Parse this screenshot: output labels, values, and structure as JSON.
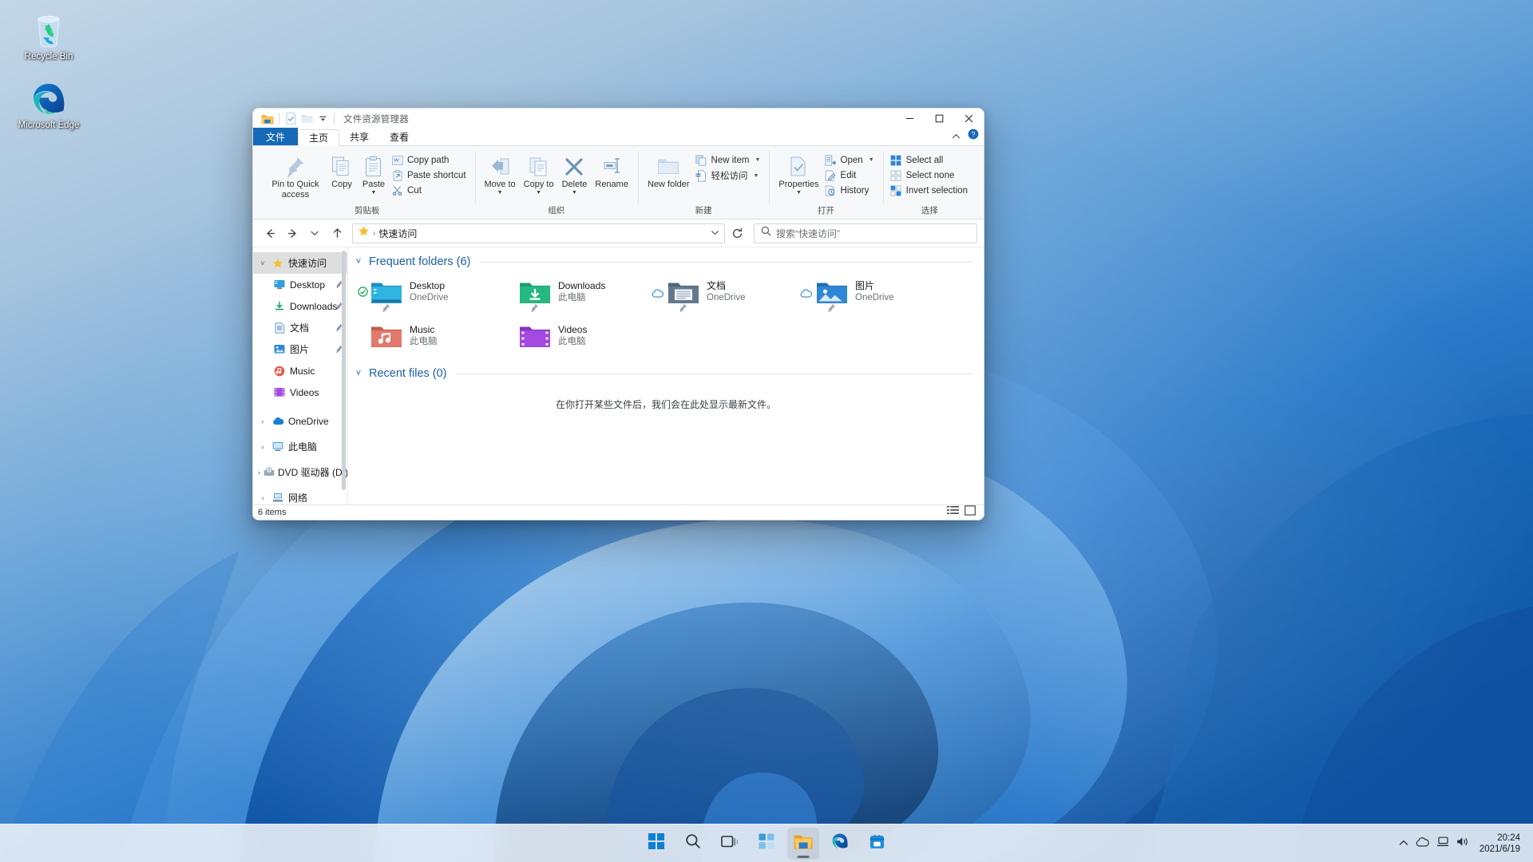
{
  "desktop": {
    "icons": [
      {
        "name": "recycle-bin",
        "label": "Recycle Bin"
      },
      {
        "name": "microsoft-edge",
        "label": "Microsoft Edge"
      }
    ]
  },
  "window": {
    "title": "文件资源管理器",
    "quick_access_toolbar": [
      {
        "name": "explorer-icon",
        "label": ""
      },
      {
        "name": "properties-icon",
        "label": ""
      },
      {
        "name": "new-folder-icon",
        "label": ""
      },
      {
        "name": "customize-dropdown",
        "label": ""
      }
    ],
    "controls": {
      "minimize": "─",
      "maximize": "□",
      "close": "✕"
    }
  },
  "tabs": [
    {
      "name": "tab-file",
      "label": "文件",
      "state": "file-menu"
    },
    {
      "name": "tab-home",
      "label": "主页",
      "state": "active"
    },
    {
      "name": "tab-share",
      "label": "共享",
      "state": "normal"
    },
    {
      "name": "tab-view",
      "label": "查看",
      "state": "normal"
    }
  ],
  "ribbon": {
    "collapse_label": "⌃",
    "help_label": "?",
    "groups": [
      {
        "name": "clipboard",
        "label": "剪贴板",
        "big_buttons": [
          {
            "name": "pin-to-quick-access",
            "label": "Pin to Quick access",
            "icon": "pin-icon"
          },
          {
            "name": "copy-button",
            "label": "Copy",
            "icon": "copy-icon"
          },
          {
            "name": "paste-button",
            "label": "Paste",
            "icon": "paste-icon"
          }
        ],
        "small_buttons": [
          {
            "name": "copy-path-button",
            "label": "Copy path",
            "icon": "copy-path-icon"
          },
          {
            "name": "paste-shortcut-button",
            "label": "Paste shortcut",
            "icon": "paste-shortcut-icon"
          },
          {
            "name": "cut-button",
            "label": "Cut",
            "icon": "scissors-icon"
          }
        ]
      },
      {
        "name": "organize",
        "label": "组织",
        "big_buttons": [
          {
            "name": "move-to-button",
            "label": "Move to",
            "icon": "move-to-icon",
            "dropdown": true
          },
          {
            "name": "copy-to-button",
            "label": "Copy to",
            "icon": "copy-to-icon",
            "dropdown": true
          },
          {
            "name": "delete-button",
            "label": "Delete",
            "icon": "delete-x-icon",
            "dropdown": true
          },
          {
            "name": "rename-button",
            "label": "Rename",
            "icon": "rename-icon"
          }
        ],
        "small_buttons": []
      },
      {
        "name": "new",
        "label": "新建",
        "big_buttons": [
          {
            "name": "new-folder-button",
            "label": "New folder",
            "icon": "new-folder-icon"
          }
        ],
        "small_buttons": [
          {
            "name": "new-item-button",
            "label": "New item",
            "icon": "new-item-icon",
            "dropdown": true
          },
          {
            "name": "easy-access-button",
            "label": "轻松访问",
            "icon": "easy-access-icon",
            "dropdown": true
          }
        ]
      },
      {
        "name": "open",
        "label": "打开",
        "big_buttons": [
          {
            "name": "properties-button",
            "label": "Properties",
            "icon": "properties-icon",
            "dropdown": true
          }
        ],
        "small_buttons": [
          {
            "name": "open-button",
            "label": "Open",
            "icon": "open-icon",
            "dropdown": true
          },
          {
            "name": "edit-button",
            "label": "Edit",
            "icon": "edit-icon"
          },
          {
            "name": "history-button",
            "label": "History",
            "icon": "history-icon"
          }
        ]
      },
      {
        "name": "select",
        "label": "选择",
        "big_buttons": [],
        "small_buttons": [
          {
            "name": "select-all-button",
            "label": "Select all",
            "icon": "select-all-icon"
          },
          {
            "name": "select-none-button",
            "label": "Select none",
            "icon": "select-none-icon"
          },
          {
            "name": "invert-selection-button",
            "label": "Invert selection",
            "icon": "invert-selection-icon"
          }
        ]
      }
    ]
  },
  "navigation": {
    "back": "←",
    "forward": "→",
    "recent": "˅",
    "up": "↑",
    "breadcrumb": {
      "icon": "star-icon",
      "separator": "›",
      "label": "快速访问"
    },
    "refresh_title": "refresh",
    "search": {
      "placeholder": "搜索“快速访问”",
      "icon": "search-icon"
    }
  },
  "sidebar": {
    "items": [
      {
        "name": "sidebar-item-quick-access",
        "label": "快速访问",
        "icon": "star-icon",
        "chevron": "˅",
        "indent": false,
        "selected": true,
        "pinned": false
      },
      {
        "name": "sidebar-item-desktop",
        "label": "Desktop",
        "icon": "desktop-icon",
        "chevron": "",
        "indent": true,
        "selected": false,
        "pinned": true
      },
      {
        "name": "sidebar-item-downloads",
        "label": "Downloads",
        "icon": "downloads-icon",
        "chevron": "",
        "indent": true,
        "selected": false,
        "pinned": true
      },
      {
        "name": "sidebar-item-documents",
        "label": "文档",
        "icon": "documents-icon",
        "chevron": "",
        "indent": true,
        "selected": false,
        "pinned": true
      },
      {
        "name": "sidebar-item-pictures",
        "label": "图片",
        "icon": "pictures-icon",
        "chevron": "",
        "indent": true,
        "selected": false,
        "pinned": true
      },
      {
        "name": "sidebar-item-music",
        "label": "Music",
        "icon": "music-icon",
        "chevron": "",
        "indent": true,
        "selected": false,
        "pinned": false
      },
      {
        "name": "sidebar-item-videos",
        "label": "Videos",
        "icon": "videos-icon",
        "chevron": "",
        "indent": true,
        "selected": false,
        "pinned": false
      },
      {
        "name": "sidebar-item-onedrive",
        "label": "OneDrive",
        "icon": "cloud-icon",
        "chevron": "›",
        "indent": false,
        "selected": false,
        "pinned": false
      },
      {
        "name": "sidebar-item-this-pc",
        "label": "此电脑",
        "icon": "this-pc-icon",
        "chevron": "›",
        "indent": false,
        "selected": false,
        "pinned": false
      },
      {
        "name": "sidebar-item-dvd-drive",
        "label": "DVD 驱动器 (D:)",
        "icon": "dvd-icon",
        "chevron": "›",
        "indent": false,
        "selected": false,
        "pinned": false
      },
      {
        "name": "sidebar-item-network",
        "label": "网络",
        "icon": "network-icon",
        "chevron": "›",
        "indent": false,
        "selected": false,
        "pinned": false
      }
    ]
  },
  "content": {
    "frequent_folders": {
      "chevron": "˅",
      "title": "Frequent folders (6)",
      "items": [
        {
          "name": "folder-tile-desktop",
          "title": "Desktop",
          "subtitle": "OneDrive",
          "icon": "desktop-folder-icon",
          "badge": "synced-check",
          "pinned": true
        },
        {
          "name": "folder-tile-downloads",
          "title": "Downloads",
          "subtitle": "此电脑",
          "icon": "downloads-folder-icon",
          "badge": "none",
          "pinned": true
        },
        {
          "name": "folder-tile-documents",
          "title": "文档",
          "subtitle": "OneDrive",
          "icon": "documents-folder-icon",
          "badge": "cloud",
          "pinned": true
        },
        {
          "name": "folder-tile-pictures",
          "title": "图片",
          "subtitle": "OneDrive",
          "icon": "pictures-folder-icon",
          "badge": "cloud",
          "pinned": true
        },
        {
          "name": "folder-tile-music",
          "title": "Music",
          "subtitle": "此电脑",
          "icon": "music-folder-icon",
          "badge": "none",
          "pinned": false
        },
        {
          "name": "folder-tile-videos",
          "title": "Videos",
          "subtitle": "此电脑",
          "icon": "videos-folder-icon",
          "badge": "none",
          "pinned": false
        }
      ]
    },
    "recent_files": {
      "chevron": "˅",
      "title": "Recent files (0)",
      "empty_message": "在你打开某些文件后，我们会在此处显示最新文件。"
    }
  },
  "status_bar": {
    "item_count": "6 items",
    "views": [
      {
        "name": "details-view-button",
        "icon": "details-view-icon"
      },
      {
        "name": "large-icons-view-button",
        "icon": "large-icons-view-icon"
      }
    ]
  },
  "taskbar": {
    "buttons": [
      {
        "name": "start-button",
        "icon": "windows-logo-icon",
        "active": false
      },
      {
        "name": "search-button",
        "icon": "search-icon",
        "active": false
      },
      {
        "name": "task-view-button",
        "icon": "task-view-icon",
        "active": false
      },
      {
        "name": "widgets-button",
        "icon": "widgets-icon",
        "active": false
      },
      {
        "name": "file-explorer-button",
        "icon": "file-explorer-icon",
        "active": true
      },
      {
        "name": "microsoft-edge-button",
        "icon": "edge-icon",
        "active": false
      },
      {
        "name": "microsoft-store-button",
        "icon": "store-icon",
        "active": false
      }
    ],
    "tray": {
      "overflow": "⌃",
      "icons": [
        {
          "name": "onedrive-tray-icon"
        },
        {
          "name": "network-tray-icon"
        },
        {
          "name": "volume-tray-icon"
        }
      ],
      "time": "20:24",
      "date": "2021/6/19"
    }
  },
  "colors": {
    "accent": "#1569b6",
    "link": "#1b5fa8",
    "selection": "#dededf",
    "taskbar": "#f3f6f9"
  }
}
